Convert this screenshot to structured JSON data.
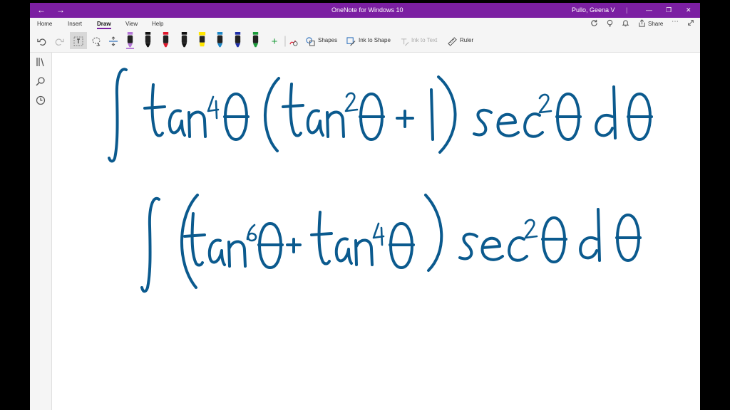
{
  "window": {
    "title": "OneNote for Windows 10",
    "user": "Pullo, Geena V"
  },
  "tabs": [
    {
      "label": "Home",
      "active": false
    },
    {
      "label": "Insert",
      "active": false
    },
    {
      "label": "Draw",
      "active": true
    },
    {
      "label": "View",
      "active": false
    },
    {
      "label": "Help",
      "active": false
    }
  ],
  "share_label": "Share",
  "ribbon": {
    "shapes_label": "Shapes",
    "ink_to_shape_label": "Ink to Shape",
    "ink_to_text_label": "Ink to Text",
    "ruler_label": "Ruler"
  },
  "pens": [
    {
      "name": "pen-purple",
      "color": "#b477d6",
      "type": "pen"
    },
    {
      "name": "pen-black-1",
      "color": "#111111",
      "type": "pen"
    },
    {
      "name": "pen-red",
      "color": "#e0182c",
      "type": "pen"
    },
    {
      "name": "pen-black-2",
      "color": "#111111",
      "type": "pen"
    },
    {
      "name": "highlighter-yellow",
      "color": "#ffe600",
      "type": "highlighter"
    },
    {
      "name": "pen-teal",
      "color": "#1e88c8",
      "type": "pen"
    },
    {
      "name": "pen-blue",
      "color": "#1f2fa8",
      "type": "pen"
    },
    {
      "name": "pen-green",
      "color": "#1a9c3a",
      "type": "pen"
    }
  ],
  "colors": {
    "accent": "#7b1fa2",
    "ink": "#0b5a8e"
  },
  "icons": {
    "back": "arrow-left-icon",
    "forward": "arrow-right-icon",
    "undo": "undo-icon",
    "redo": "redo-icon",
    "lasso": "lasso-select-icon",
    "eraser": "eraser-icon",
    "add_space": "add-space-icon",
    "add_pen": "add-pen-icon",
    "ink_replay": "ink-replay-icon",
    "sync": "sync-icon",
    "lightbulb": "lightbulb-icon",
    "bell": "bell-icon",
    "more": "more-icon",
    "expand": "expand-icon",
    "notebooks": "notebooks-icon",
    "search": "search-icon",
    "recent": "clock-icon"
  }
}
